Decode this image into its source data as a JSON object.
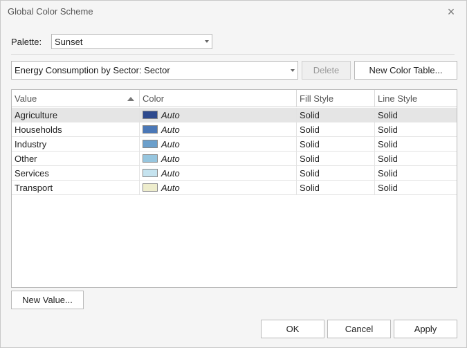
{
  "window": {
    "title": "Global Color Scheme",
    "close_glyph": "×"
  },
  "palette": {
    "label": "Palette:",
    "value": "Sunset"
  },
  "color_table": {
    "value": "Energy Consumption by Sector: Sector",
    "delete_label": "Delete",
    "new_table_label": "New Color Table..."
  },
  "grid": {
    "columns": [
      "Value",
      "Color",
      "Fill Style",
      "Line Style"
    ],
    "rows": [
      {
        "value": "Agriculture",
        "color": "#2e4a8e",
        "color_text": "Auto",
        "fill": "Solid",
        "line": "Solid"
      },
      {
        "value": "Households",
        "color": "#4b78b7",
        "color_text": "Auto",
        "fill": "Solid",
        "line": "Solid"
      },
      {
        "value": "Industry",
        "color": "#6b9fcb",
        "color_text": "Auto",
        "fill": "Solid",
        "line": "Solid"
      },
      {
        "value": "Other",
        "color": "#97c6df",
        "color_text": "Auto",
        "fill": "Solid",
        "line": "Solid"
      },
      {
        "value": "Services",
        "color": "#c5e3ef",
        "color_text": "Auto",
        "fill": "Solid",
        "line": "Solid"
      },
      {
        "value": "Transport",
        "color": "#eeedcd",
        "color_text": "Auto",
        "fill": "Solid",
        "line": "Solid"
      }
    ],
    "selected_row": 0
  },
  "buttons": {
    "new_value": "New Value...",
    "ok": "OK",
    "cancel": "Cancel",
    "apply": "Apply"
  }
}
